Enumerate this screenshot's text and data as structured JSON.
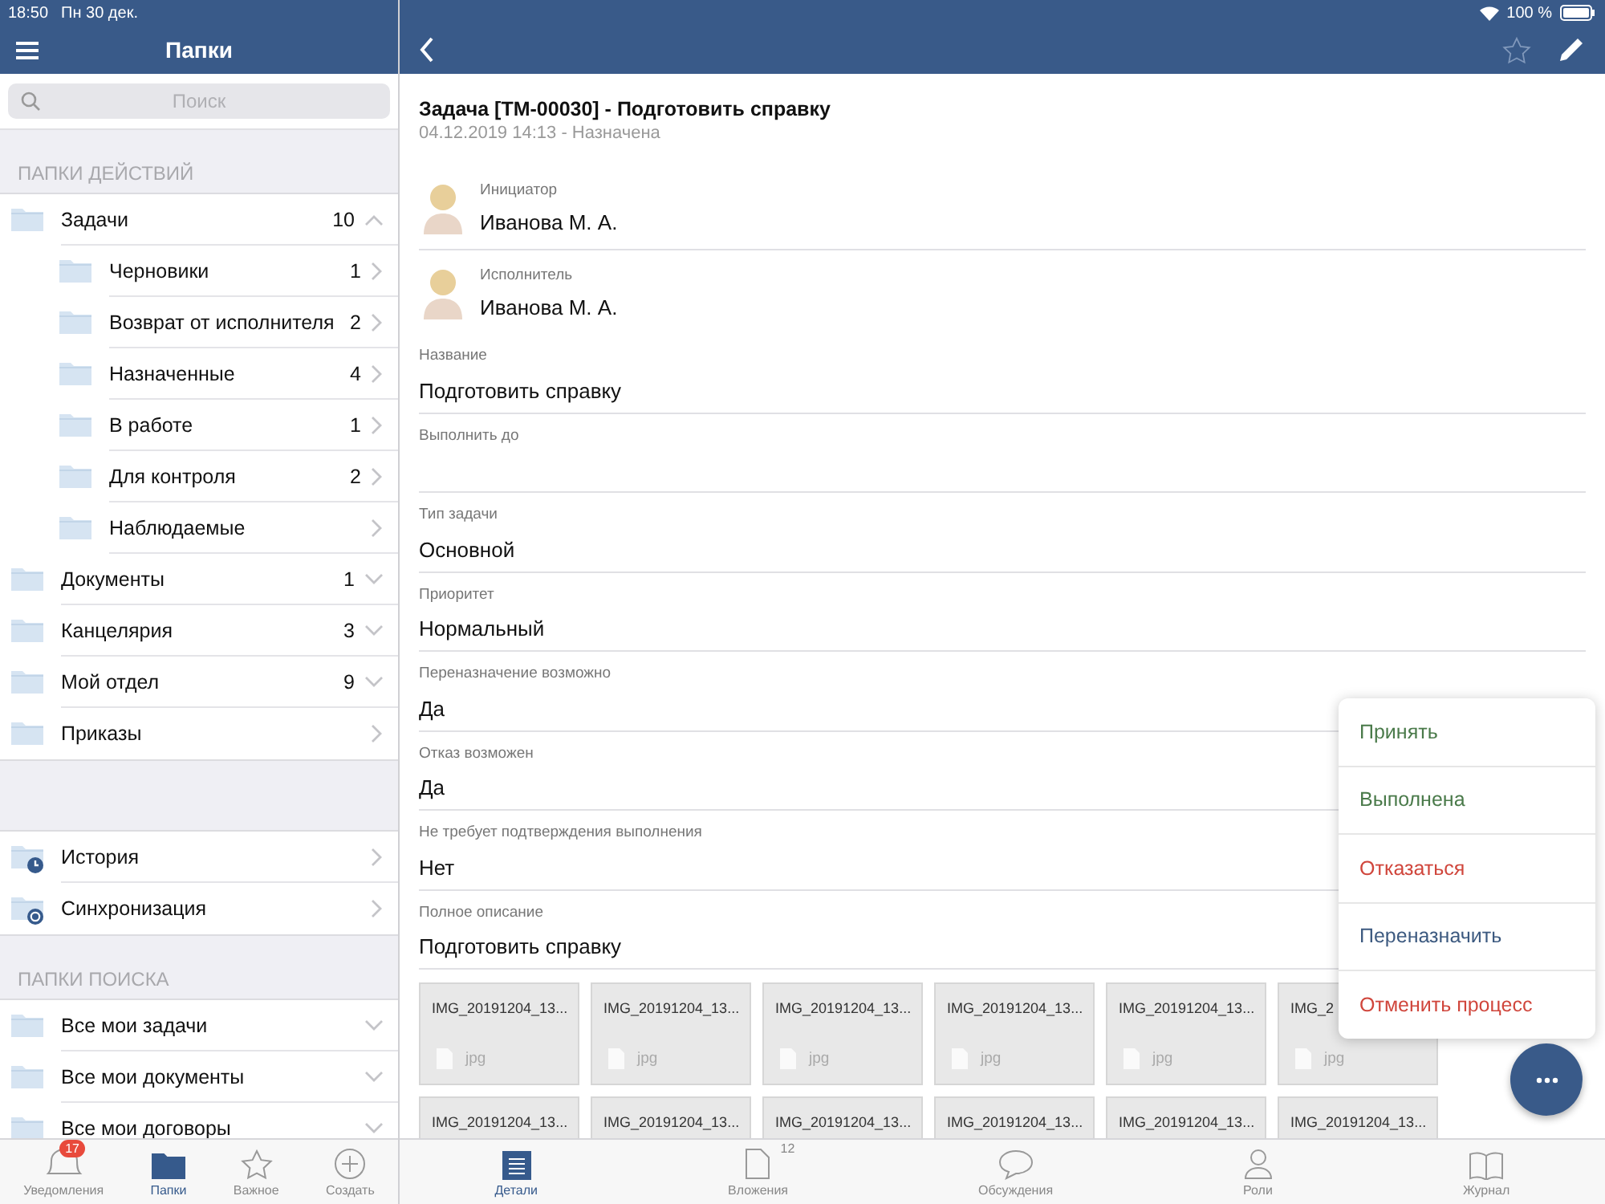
{
  "status_bar": {
    "time": "18:50",
    "date": "Пн 30 дек.",
    "battery": "100 %"
  },
  "sidebar": {
    "title": "Папки",
    "search": {
      "placeholder": "Поиск"
    },
    "sections": [
      {
        "header": "ПАПКИ ДЕЙСТВИЙ",
        "items": [
          {
            "label": "Задачи",
            "count": "10",
            "kind": "group",
            "expanded": true,
            "children": [
              {
                "label": "Черновики",
                "count": "1",
                "kind": "folder"
              },
              {
                "label": "Возврат от исполнителя",
                "count": "2",
                "kind": "folder"
              },
              {
                "label": "Назначенные",
                "count": "4",
                "kind": "folder"
              },
              {
                "label": "В работе",
                "count": "1",
                "kind": "folder"
              },
              {
                "label": "Для контроля",
                "count": "2",
                "kind": "folder"
              },
              {
                "label": "Наблюдаемые",
                "kind": "folder"
              }
            ]
          },
          {
            "label": "Документы",
            "count": "1",
            "kind": "group",
            "expanded": false
          },
          {
            "label": "Канцелярия",
            "count": "3",
            "kind": "group",
            "expanded": false
          },
          {
            "label": "Мой отдел",
            "count": "9",
            "kind": "group",
            "expanded": false
          },
          {
            "label": "Приказы",
            "kind": "folder"
          }
        ]
      },
      {
        "items": [
          {
            "label": "История",
            "kind": "clock"
          },
          {
            "label": "Синхронизация",
            "kind": "sync"
          }
        ]
      },
      {
        "header": "ПАПКИ ПОИСКА",
        "items": [
          {
            "label": "Все мои задачи",
            "kind": "group",
            "expanded": false
          },
          {
            "label": "Все мои документы",
            "kind": "group",
            "expanded": false
          },
          {
            "label": "Все мои договоры",
            "kind": "group",
            "expanded": false
          }
        ]
      }
    ],
    "tabs": [
      {
        "label": "Уведомления",
        "kind": "bell",
        "badge": "17",
        "selected": false
      },
      {
        "label": "Папки",
        "kind": "folder",
        "selected": true
      },
      {
        "label": "Важное",
        "kind": "star",
        "selected": false
      },
      {
        "label": "Создать",
        "kind": "plus",
        "selected": false
      }
    ]
  },
  "task": {
    "title": "Задача [ТМ-00030] - Подготовить справку",
    "subtitle": "04.12.2019 14:13 - Назначена",
    "people": [
      {
        "role": "Инициатор",
        "name": "Иванова М. А."
      },
      {
        "role": "Исполнитель",
        "name": "Иванова М. А."
      }
    ],
    "fields": [
      {
        "label": "Название",
        "value": "Подготовить справку"
      },
      {
        "label": "Выполнить до"
      },
      {
        "label": "Тип задачи",
        "value": "Основной"
      },
      {
        "label": "Приоритет",
        "value": "Нормальный"
      },
      {
        "label": "Переназначение возможно",
        "value": "Да"
      },
      {
        "label": "Отказ возможен",
        "value": "Да"
      },
      {
        "label": "Не требует подтверждения выполнения",
        "value": "Нет"
      },
      {
        "label": "Полное описание",
        "value": "Подготовить справку"
      }
    ],
    "attachments": [
      {
        "name": "IMG_20191204_13...",
        "type": "jpg"
      },
      {
        "name": "IMG_20191204_13...",
        "type": "jpg"
      },
      {
        "name": "IMG_20191204_13...",
        "type": "jpg"
      },
      {
        "name": "IMG_20191204_13...",
        "type": "jpg"
      },
      {
        "name": "IMG_20191204_13...",
        "type": "jpg"
      },
      {
        "name": "IMG_2",
        "type": "jpg"
      },
      {
        "name": "IMG_20191204_13..."
      },
      {
        "name": "IMG_20191204_13..."
      },
      {
        "name": "IMG_20191204_13..."
      },
      {
        "name": "IMG_20191204_13..."
      },
      {
        "name": "IMG_20191204_13..."
      },
      {
        "name": "IMG_20191204_13..."
      }
    ]
  },
  "actions_menu": [
    {
      "label": "Принять",
      "color": "#4a7a4a"
    },
    {
      "label": "Выполнена",
      "color": "#4a7a4a"
    },
    {
      "label": "Отказаться",
      "color": "#d0463c"
    },
    {
      "label": "Переназначить",
      "color": "#3d5a80"
    },
    {
      "label": "Отменить процесс",
      "color": "#d0463c"
    }
  ],
  "tabs": [
    {
      "label": "Детали",
      "kind": "details",
      "selected": true
    },
    {
      "label": "Вложения",
      "kind": "doc",
      "count": "12",
      "selected": false
    },
    {
      "label": "Обсуждения",
      "kind": "chat",
      "selected": false
    },
    {
      "label": "Роли",
      "kind": "person",
      "selected": false
    },
    {
      "label": "Журнал",
      "kind": "book",
      "selected": false
    }
  ]
}
